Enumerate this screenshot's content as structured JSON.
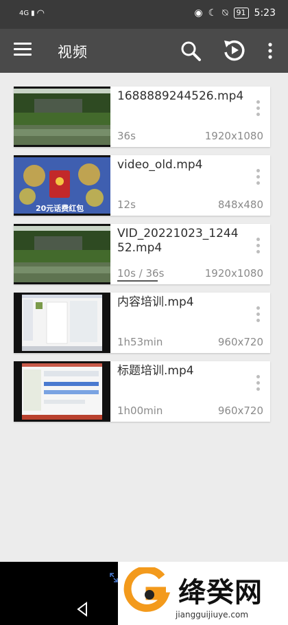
{
  "status_bar": {
    "network": "4G",
    "battery": "91",
    "time": "5:23"
  },
  "toolbar": {
    "title": "视频"
  },
  "videos": [
    {
      "name": "1688889244526.mp4",
      "duration": "36s",
      "resolution": "1920x1080",
      "thumb": "scenery"
    },
    {
      "name": "video_old.mp4",
      "duration": "12s",
      "resolution": "848x480",
      "thumb": "game",
      "thumb_text": "20元话费红包"
    },
    {
      "name": "VID_20221023_124452.mp4",
      "duration": "10s / 36s",
      "resolution": "1920x1080",
      "thumb": "scenery",
      "progress": 0.28
    },
    {
      "name": "内容培训.mp4",
      "duration": "1h53min",
      "resolution": "960x720",
      "thumb": "screen"
    },
    {
      "name": "标题培训.mp4",
      "duration": "1h00min",
      "resolution": "960x720",
      "thumb": "screen"
    }
  ],
  "watermark": {
    "brand": "绛癸网",
    "url": "jiangguijiuye.com"
  }
}
